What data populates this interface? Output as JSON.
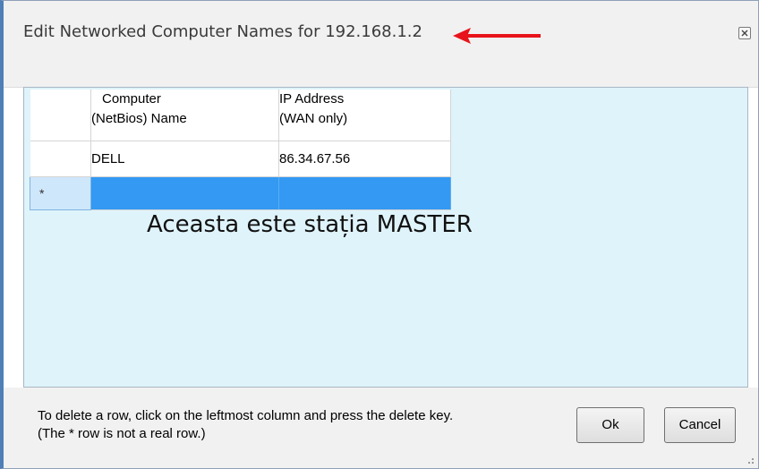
{
  "window": {
    "title": "Edit Networked Computer Names for 192.168.1.2"
  },
  "grid": {
    "columns": [
      {
        "line1": "Computer",
        "line2": "(NetBios) Name"
      },
      {
        "line1": "IP Address",
        "line2": "(WAN only)"
      }
    ],
    "rows": [
      {
        "name": "DELL",
        "ip": "86.34.67.56"
      }
    ],
    "new_row_marker": "*"
  },
  "annotation": {
    "text": "Aceasta este stația MASTER",
    "arrow_color": "#e8141b"
  },
  "footer": {
    "help_line1": "To delete a row, click on the leftmost column and press the delete key.",
    "help_line2": "(The * row is not a real row.)",
    "ok_label": "Ok",
    "cancel_label": "Cancel"
  },
  "icons": {
    "close": "close-icon",
    "resize": "resize-grip-icon"
  }
}
